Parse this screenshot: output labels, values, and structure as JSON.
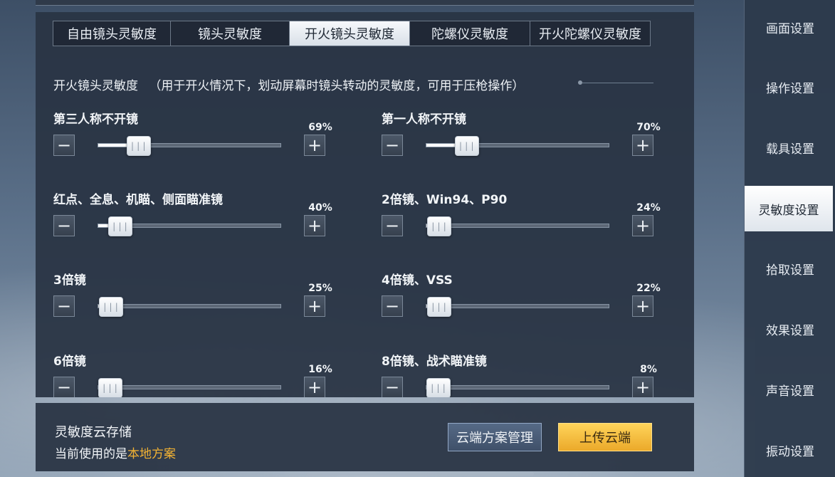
{
  "tabs": [
    {
      "label": "自由镜头灵敏度",
      "active": false
    },
    {
      "label": "镜头灵敏度",
      "active": false
    },
    {
      "label": "开火镜头灵敏度",
      "active": true
    },
    {
      "label": "陀螺仪灵敏度",
      "active": false
    },
    {
      "label": "开火陀螺仪灵敏度",
      "active": false
    }
  ],
  "section": {
    "title": "开火镜头灵敏度",
    "description": "（用于开火情况下，划动屏幕时镜头转动的灵敏度，可用于压枪操作）"
  },
  "settings": [
    {
      "label": "第三人称不开镜",
      "value_text": "69%",
      "level": 0.22
    },
    {
      "label": "第一人称不开镜",
      "value_text": "70%",
      "level": 0.22
    },
    {
      "label": "红点、全息、机瞄、侧面瞄准镜",
      "value_text": "40%",
      "level": 0.12
    },
    {
      "label": "2倍镜、Win94、P90",
      "value_text": "24%",
      "level": 0.07
    },
    {
      "label": "3倍镜",
      "value_text": "25%",
      "level": 0.07
    },
    {
      "label": "4倍镜、VSS",
      "value_text": "22%",
      "level": 0.07
    },
    {
      "label": "6倍镜",
      "value_text": "16%",
      "level": 0.05
    },
    {
      "label": "8倍镜、战术瞄准镜",
      "value_text": "8%",
      "level": 0.02
    }
  ],
  "controls": {
    "minus": "−",
    "plus": "+",
    "grip": "|||"
  },
  "cloud": {
    "title": "灵敏度云存储",
    "current_prefix": "当前使用的是",
    "current_scheme": "本地方案",
    "manage_label": "云端方案管理",
    "upload_label": "上传云端"
  },
  "sidebar": [
    {
      "label": "画面设置",
      "active": false
    },
    {
      "label": "操作设置",
      "active": false
    },
    {
      "label": "载具设置",
      "active": false
    },
    {
      "label": "灵敏度设置",
      "active": true
    },
    {
      "label": "拾取设置",
      "active": false
    },
    {
      "label": "效果设置",
      "active": false
    },
    {
      "label": "声音设置",
      "active": false
    },
    {
      "label": "振动设置",
      "active": false
    }
  ],
  "colors": {
    "accent_gold": "#f2b233",
    "upload_button": "#f4c043",
    "panel": "#293444"
  }
}
